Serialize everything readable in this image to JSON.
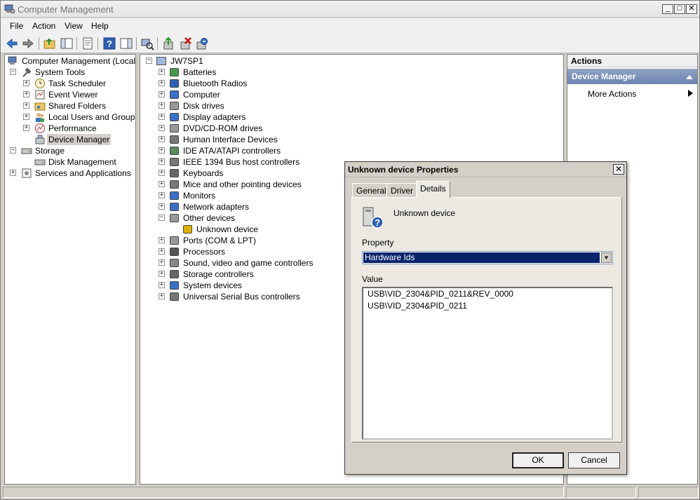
{
  "window": {
    "title": "Computer Management",
    "min": "_",
    "max": "□",
    "close": "✕"
  },
  "menu": [
    "File",
    "Action",
    "View",
    "Help"
  ],
  "left_tree": {
    "root": "Computer Management (Local)",
    "items": [
      {
        "label": "System Tools",
        "exp": "−"
      },
      {
        "label": "Task Scheduler",
        "exp": "+"
      },
      {
        "label": "Event Viewer",
        "exp": "+"
      },
      {
        "label": "Shared Folders",
        "exp": "+"
      },
      {
        "label": "Local Users and Groups",
        "exp": "+"
      },
      {
        "label": "Performance",
        "exp": "+"
      },
      {
        "label": "Device Manager",
        "exp": ""
      },
      {
        "label": "Storage",
        "exp": "−"
      },
      {
        "label": "Disk Management",
        "exp": ""
      },
      {
        "label": "Services and Applications",
        "exp": "+"
      }
    ]
  },
  "device_tree": {
    "root": "JW7SP1",
    "categories": [
      "Batteries",
      "Bluetooth Radios",
      "Computer",
      "Disk drives",
      "Display adapters",
      "DVD/CD-ROM drives",
      "Human Interface Devices",
      "IDE ATA/ATAPI controllers",
      "IEEE 1394 Bus host controllers",
      "Keyboards",
      "Mice and other pointing devices",
      "Monitors",
      "Network adapters",
      "Other devices",
      "Unknown device",
      "Ports (COM & LPT)",
      "Processors",
      "Sound, video and game controllers",
      "Storage controllers",
      "System devices",
      "Universal Serial Bus controllers"
    ]
  },
  "actions": {
    "header": "Actions",
    "section": "Device Manager",
    "more": "More Actions"
  },
  "dialog": {
    "title": "Unknown device Properties",
    "tabs": [
      "General",
      "Driver",
      "Details"
    ],
    "device_name": "Unknown device",
    "property_label": "Property",
    "property_value": "Hardware Ids",
    "value_label": "Value",
    "values": [
      "USB\\VID_2304&PID_0211&REV_0000",
      "USB\\VID_2304&PID_0211"
    ],
    "ok": "OK",
    "cancel": "Cancel"
  },
  "colors": {
    "selection": "#0a246a",
    "actions_section": "#6c84b2"
  }
}
